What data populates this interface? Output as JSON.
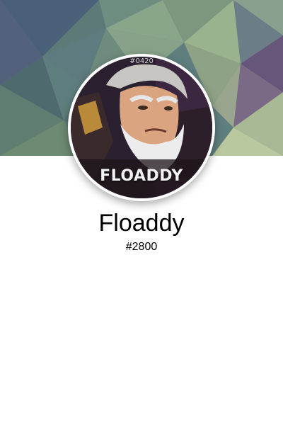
{
  "profile": {
    "username": "Floaddy",
    "discriminator": "#2800"
  },
  "avatar": {
    "caption": "FLOADDY",
    "tag": "#0420",
    "icon": "avatar-portrait"
  },
  "colors": {
    "background": "#ffffff",
    "banner_base": "#5f7f7e",
    "text": "#000000"
  }
}
